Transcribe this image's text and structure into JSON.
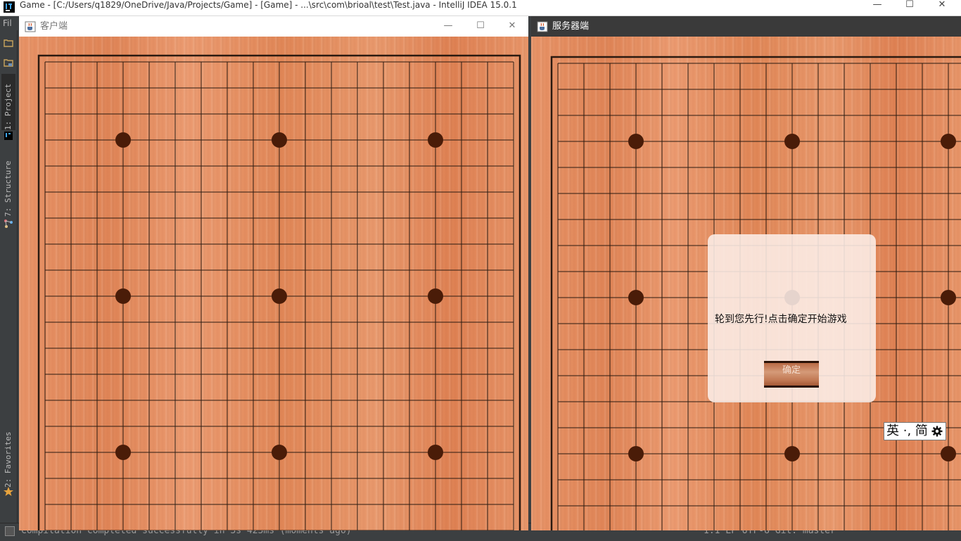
{
  "ide": {
    "window_title": "Game - [C:/Users/q1829/OneDrive/Java/Projects/Game] - [Game] - ...\\src\\com\\brioal\\test\\Test.java - IntelliJ IDEA 15.0.1",
    "menu_peek": "Fil",
    "left_tabs": {
      "project": "1: Project",
      "structure": "7: Structure",
      "favorites": "2: Favorites"
    },
    "status_text": "Compilation completed successfully in 3s 423ms (moments ago)",
    "status_right": "1:1  LF  UTF-8  Git: master",
    "colors": {
      "background": "#3c3f41",
      "titlebar": "#ffffff"
    }
  },
  "client_window": {
    "title": "客户端",
    "icons": [
      "java-cup-icon",
      "minimize-icon",
      "maximize-icon",
      "close-icon"
    ]
  },
  "server_window": {
    "title": "服务器端",
    "icons": [
      "java-cup-icon"
    ],
    "dialog": {
      "message": "轮到您先行!点击确定开始游戏",
      "button_label": "确定"
    }
  },
  "board": {
    "grid_lines": 19,
    "star_points": 9,
    "colors": {
      "wood": "#e58d62",
      "line": "#2b1a10",
      "star": "#4a1c08"
    }
  },
  "ime": {
    "label": "英 ·, 简",
    "icon": "gear-icon"
  }
}
